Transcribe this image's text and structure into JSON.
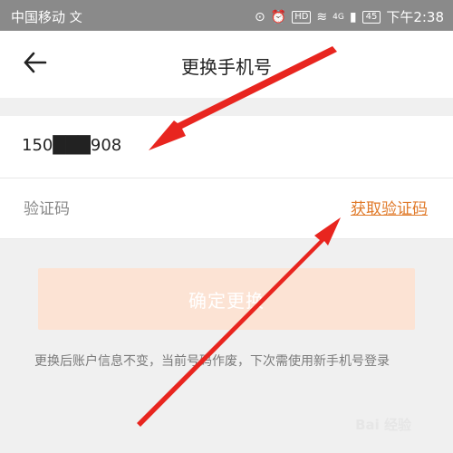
{
  "status_bar": {
    "carrier": "中国移动",
    "carrier_icon": "文",
    "hd": "HD",
    "signal": "4G",
    "battery": "45",
    "time": "下午2:38"
  },
  "header": {
    "title": "更换手机号",
    "back_icon": "arrow-left-icon"
  },
  "form": {
    "phone_value": "150███908",
    "code_placeholder": "验证码",
    "get_code_label": "获取验证码"
  },
  "confirm_label": "确定更换",
  "notice_text": "更换后账户信息不变，当前号码作废，下次需使用新手机号登录",
  "watermark": "Bai 经验",
  "colors": {
    "accent": "#e07a2a",
    "button_disabled_bg": "#fce3d4",
    "status_bar_bg": "#8a8a8a",
    "annotation_arrow": "#e8251f"
  }
}
